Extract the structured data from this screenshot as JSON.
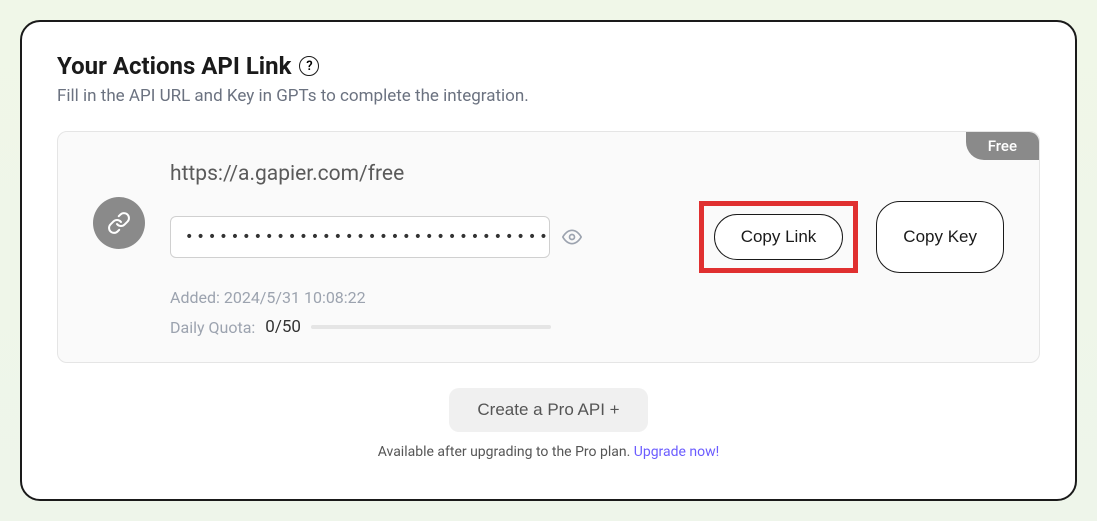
{
  "header": {
    "title": "Your Actions API Link",
    "help_icon": "?",
    "subtitle": "Fill in the API URL and Key in GPTs to complete the integration."
  },
  "api_card": {
    "badge": "Free",
    "url": "https://a.gapier.com/free",
    "masked_key": "•••••••••••••••••••••••••••••••••••••••••",
    "added_label": "Added: 2024/5/31 10:08:22",
    "quota_label": "Daily Quota:",
    "quota_value": "0/50",
    "copy_link_label": "Copy Link",
    "copy_key_label": "Copy Key"
  },
  "footer": {
    "pro_button": "Create a Pro API +",
    "upgrade_text": "Available after upgrading to the Pro plan. ",
    "upgrade_link": "Upgrade now!"
  }
}
